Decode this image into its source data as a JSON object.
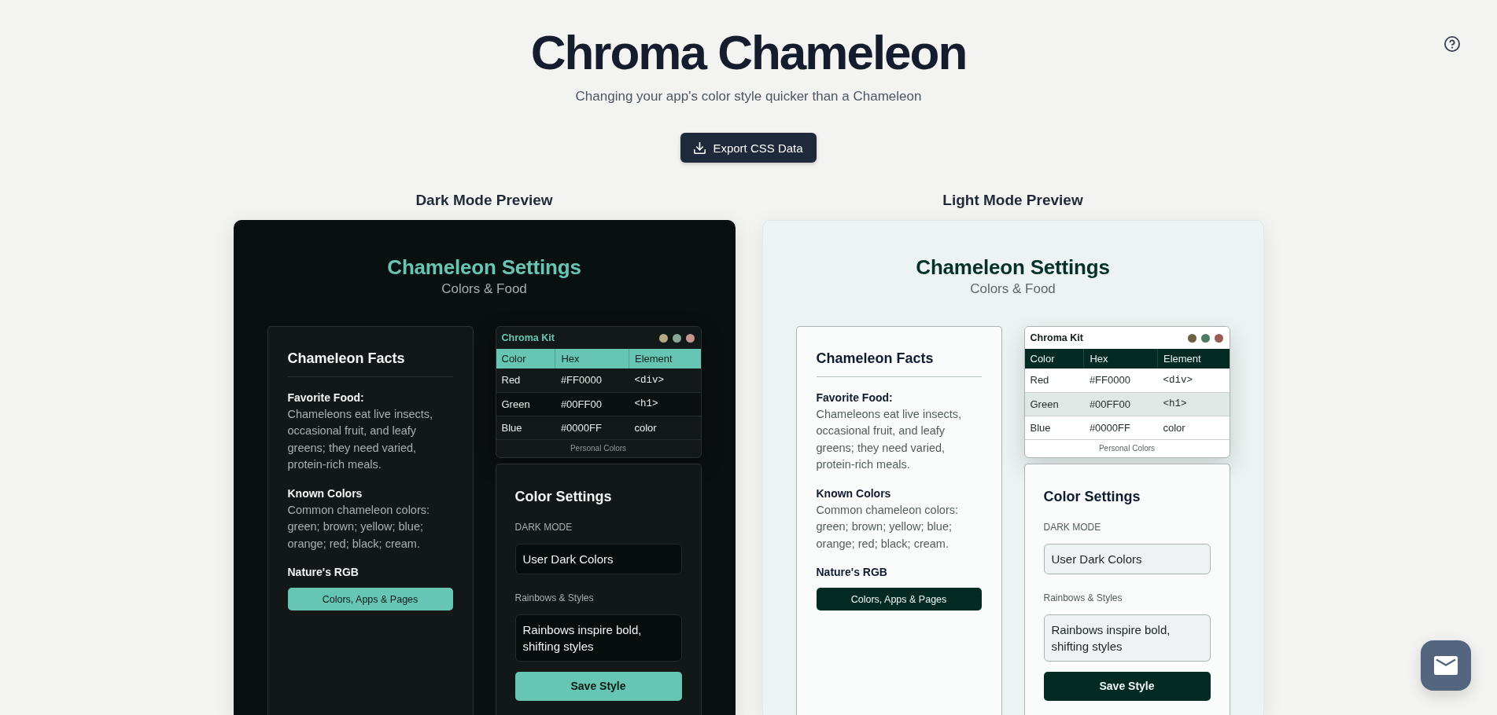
{
  "header": {
    "title": "Chroma Chameleon",
    "subtitle": "Changing your app's color style quicker than a Chameleon",
    "export_button": "Export CSS Data"
  },
  "previews": [
    {
      "label": "Dark Mode Preview",
      "kind": "dark",
      "title": "Chameleon Settings",
      "subtitle": "Colors & Food",
      "facts": {
        "title": "Chameleon Facts",
        "items": [
          {
            "heading": "Favorite Food:",
            "text": "Chameleons eat live insects, occasional fruit, and leafy greens; they need varied, protein-rich meals."
          },
          {
            "heading": "Known Colors",
            "text": "Common chameleon colors: green; brown; yellow; blue; orange; red; black; cream."
          }
        ],
        "cta_heading": "Nature's RGB",
        "cta_button": "Colors, Apps & Pages"
      },
      "chroma_kit": {
        "title": "Chroma Kit",
        "dots": [
          {
            "color": "#b5a884"
          },
          {
            "color": "#88a797"
          },
          {
            "color": "#c99590"
          }
        ],
        "columns": [
          "Color",
          "Hex",
          "Element"
        ],
        "rows": [
          [
            {
              "text": "Red",
              "kind": "text"
            },
            {
              "text": "#FF0000",
              "kind": "text"
            },
            {
              "text": "<div>",
              "kind": "code"
            }
          ],
          [
            {
              "text": "Green",
              "kind": "text"
            },
            {
              "text": "#00FF00",
              "kind": "text"
            },
            {
              "text": "<h1>",
              "kind": "code"
            }
          ],
          [
            {
              "text": "Blue",
              "kind": "text"
            },
            {
              "text": "#0000FF",
              "kind": "text"
            },
            {
              "text": "color",
              "kind": "text"
            }
          ]
        ],
        "footer": "Personal Colors"
      },
      "color_settings": {
        "title": "Color Settings",
        "fields": [
          {
            "label": "DARK MODE",
            "value": "User Dark Colors",
            "kind": "input"
          },
          {
            "label": "Rainbows & Styles",
            "value": "Rainbows inspire bold, shifting styles",
            "kind": "textarea"
          }
        ],
        "button": "Save Style"
      }
    },
    {
      "label": "Light Mode Preview",
      "kind": "light",
      "title": "Chameleon Settings",
      "subtitle": "Colors & Food",
      "facts": {
        "title": "Chameleon Facts",
        "items": [
          {
            "heading": "Favorite Food:",
            "text": "Chameleons eat live insects, occasional fruit, and leafy greens; they need varied, protein-rich meals."
          },
          {
            "heading": "Known Colors",
            "text": "Common chameleon colors: green; brown; yellow; blue; orange; red; black; cream."
          }
        ],
        "cta_heading": "Nature's RGB",
        "cta_button": "Colors, Apps & Pages"
      },
      "chroma_kit": {
        "title": "Chroma Kit",
        "dots": [
          {
            "color": "#6b6242"
          },
          {
            "color": "#4c7a62"
          },
          {
            "color": "#9b5b55"
          }
        ],
        "columns": [
          "Color",
          "Hex",
          "Element"
        ],
        "rows": [
          [
            {
              "text": "Red",
              "kind": "text"
            },
            {
              "text": "#FF0000",
              "kind": "text"
            },
            {
              "text": "<div>",
              "kind": "code"
            }
          ],
          [
            {
              "text": "Green",
              "kind": "text"
            },
            {
              "text": "#00FF00",
              "kind": "text"
            },
            {
              "text": "<h1>",
              "kind": "code"
            }
          ],
          [
            {
              "text": "Blue",
              "kind": "text"
            },
            {
              "text": "#0000FF",
              "kind": "text"
            },
            {
              "text": "color",
              "kind": "text"
            }
          ]
        ],
        "footer": "Personal Colors"
      },
      "color_settings": {
        "title": "Color Settings",
        "fields": [
          {
            "label": "DARK MODE",
            "value": "User Dark Colors",
            "kind": "input"
          },
          {
            "label": "Rainbows & Styles",
            "value": "Rainbows inspire bold, shifting styles",
            "kind": "textarea"
          }
        ],
        "button": "Save Style"
      }
    }
  ]
}
